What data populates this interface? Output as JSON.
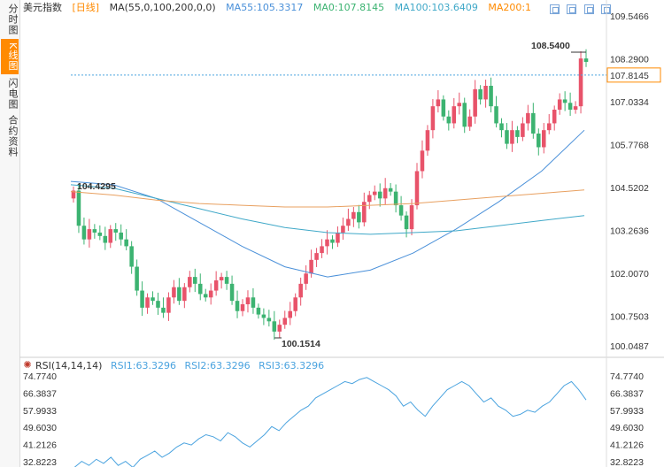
{
  "sidebar": {
    "tabs": [
      {
        "label": "分时图",
        "active": false
      },
      {
        "label": "K线图",
        "active": true
      },
      {
        "label": "闪电图",
        "active": false
      },
      {
        "label": "合约资料",
        "active": false
      }
    ]
  },
  "header": {
    "symbol": "美元指数",
    "period": "[日线]",
    "ma_label": "MA(55,0,100,200,0,0)",
    "ma55": "MA55:105.3317",
    "ma0": "MA0:107.8145",
    "ma100": "MA100:103.6409",
    "ma200": "MA200:1"
  },
  "rsi_header": {
    "label": "RSI(14,14,14)",
    "rsi1": "RSI1:63.3296",
    "rsi2": "RSI2:63.3296",
    "rsi3": "RSI3:63.3296"
  },
  "colors": {
    "up": "#e8536a",
    "down": "#3cb371",
    "ma55": "#4a90d9",
    "ma100": "#3fa8c8",
    "ma200": "#e8a060",
    "rsi": "#4aa3df",
    "current": "#ff8a00",
    "ma_label": "#333333",
    "ma55_label": "#4a90d9",
    "ma0_label": "#3cb371",
    "ma100_label": "#3fa8c8",
    "ma200_label": "#ff8a00"
  },
  "chart_data": [
    {
      "type": "candlestick",
      "title": "美元指数 [日线]",
      "y_ticks": [
        "109.5466",
        "108.2900",
        "107.0334",
        "105.7768",
        "104.5202",
        "103.2636",
        "102.0070",
        "100.7503"
      ],
      "ylim": [
        100.0487,
        109.5466
      ],
      "axis_min_label": "100.0487",
      "current_price": "107.8145",
      "high_label": "108.5400",
      "low_label": "100.1514",
      "start_label": "104.4295",
      "closes": [
        104.43,
        103.4,
        103.0,
        103.3,
        103.2,
        103.1,
        102.9,
        103.3,
        103.2,
        103.0,
        102.8,
        102.2,
        101.5,
        101.0,
        101.3,
        101.2,
        101.0,
        100.85,
        101.3,
        101.6,
        101.2,
        101.6,
        101.9,
        101.7,
        101.4,
        101.3,
        101.5,
        101.8,
        101.9,
        101.7,
        101.2,
        100.9,
        101.1,
        101.3,
        101.0,
        100.8,
        100.7,
        100.6,
        100.3,
        100.5,
        100.7,
        100.9,
        101.3,
        101.7,
        102.0,
        102.4,
        102.6,
        102.8,
        103.0,
        102.9,
        103.2,
        103.4,
        103.6,
        103.8,
        103.5,
        104.1,
        104.3,
        104.4,
        104.2,
        104.5,
        104.4,
        104.0,
        103.7,
        103.3,
        104.0,
        105.0,
        105.6,
        106.2,
        106.9,
        107.1,
        106.6,
        106.4,
        106.9,
        107.0,
        106.3,
        106.6,
        107.4,
        107.1,
        107.5,
        106.9,
        106.4,
        106.2,
        105.8,
        106.2,
        106.0,
        106.4,
        106.7,
        106.1,
        105.7,
        106.2,
        106.4,
        106.8,
        107.1,
        107.0,
        106.8,
        106.9,
        108.3,
        108.2
      ],
      "series": [
        {
          "name": "MA55",
          "values": [
            104.7,
            104.6,
            104.2,
            103.5,
            102.8,
            102.2,
            101.9,
            102.1,
            102.6,
            103.3,
            104.1,
            105.0,
            106.2
          ]
        },
        {
          "name": "MA100",
          "values": [
            104.6,
            104.5,
            104.2,
            103.9,
            103.6,
            103.35,
            103.2,
            103.15,
            103.2,
            103.25,
            103.4,
            103.55,
            103.7
          ]
        },
        {
          "name": "MA200",
          "values": [
            104.4,
            104.3,
            104.15,
            104.05,
            104.0,
            103.95,
            103.95,
            104.0,
            104.05,
            104.15,
            104.25,
            104.35,
            104.45
          ]
        }
      ]
    },
    {
      "type": "line",
      "title": "RSI(14,14,14)",
      "y_ticks": [
        "74.7740",
        "66.3837",
        "57.9933",
        "49.6030",
        "41.2126",
        "32.8223"
      ],
      "ylim": [
        32.8223,
        74.774
      ],
      "series": [
        {
          "name": "RSI1",
          "values": [
            30,
            33,
            31,
            34,
            32,
            35,
            31,
            33,
            30,
            34,
            36,
            38,
            35,
            37,
            40,
            42,
            41,
            44,
            46,
            45,
            43,
            47,
            45,
            42,
            40,
            43,
            46,
            50,
            48,
            52,
            55,
            58,
            60,
            64,
            66,
            68,
            70,
            72,
            71,
            73,
            74,
            72,
            70,
            68,
            65,
            60,
            62,
            58,
            55,
            60,
            64,
            68,
            70,
            72,
            70,
            66,
            62,
            64,
            60,
            58,
            55,
            56,
            58,
            57,
            60,
            62,
            66,
            70,
            72,
            68,
            63
          ]
        }
      ]
    }
  ]
}
